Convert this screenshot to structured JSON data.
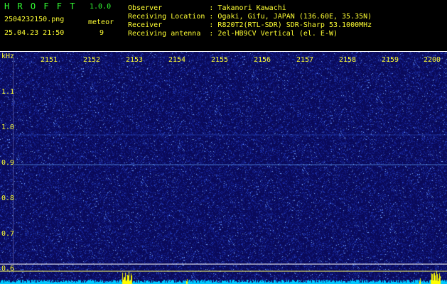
{
  "header": {
    "app_name": "H R O F F T",
    "version": "1.0.0",
    "filename": "2504232150.png",
    "datetime": "25.04.23 21:50",
    "meteor_label": "meteor",
    "meteor_count": "9",
    "observer": "Observer           : Takanori Kawachi",
    "location": "Receiving Location : Ogaki, Gifu, JAPAN (136.60E, 35.35N)",
    "receiver": "Receiver           : R820T2(RTL-SDR) SDR-Sharp 53.1000MHz",
    "antenna": "Receiving antenna  : 2el-HB9CV Vertical (el. E-W)"
  },
  "axis": {
    "unit": "kHz",
    "time_ticks": [
      "2151",
      "2152",
      "2153",
      "2154",
      "2155",
      "2156",
      "2157",
      "2158",
      "2159",
      "2200"
    ],
    "freq_ticks": [
      "1.1",
      "1.0",
      "0.9",
      "0.8",
      "0.7",
      "0.6"
    ]
  },
  "colors": {
    "label_yellow": "#ffff33",
    "label_green": "#33ff33",
    "background_blue": "#0a0a5a",
    "signal_cyan": "#00ccff",
    "meteor_yellow": "#ffff00"
  }
}
